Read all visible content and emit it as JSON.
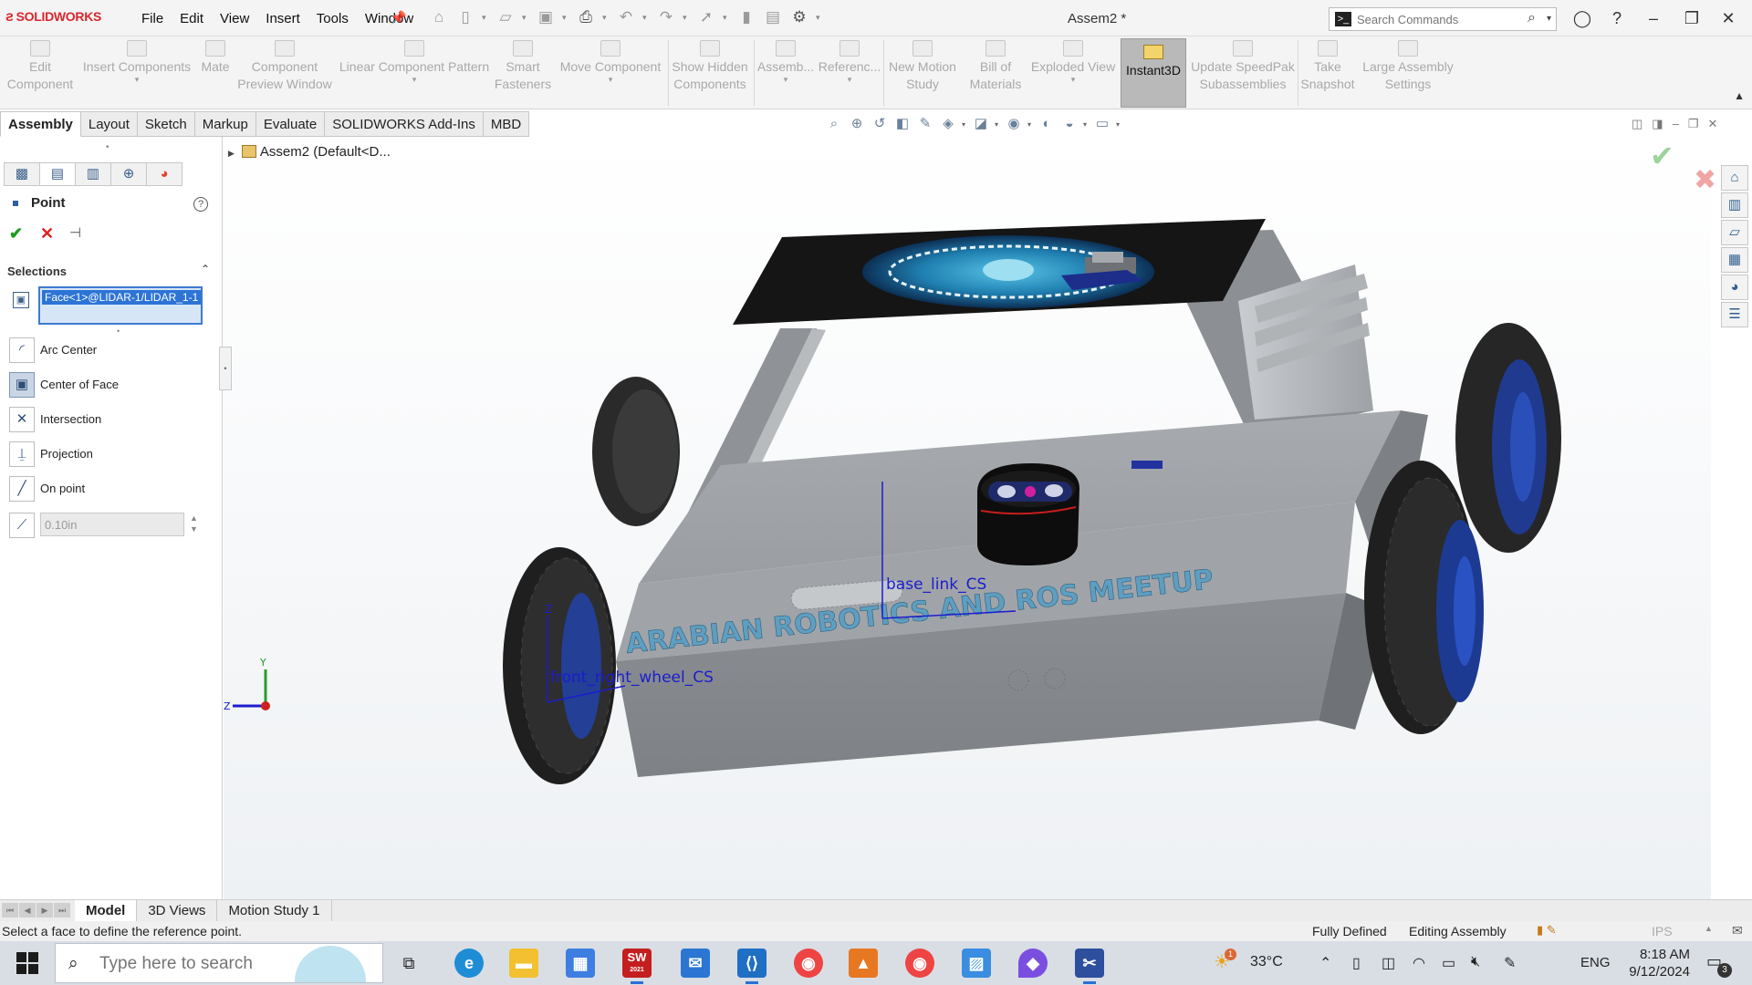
{
  "app": {
    "logo": "SOLIDWORKS",
    "document_title": "Assem2 *",
    "menus": [
      "File",
      "Edit",
      "View",
      "Insert",
      "Tools",
      "Window"
    ],
    "search_placeholder": "Search Commands"
  },
  "command_manager": {
    "buttons": [
      {
        "label1": "Edit",
        "label2": "Component"
      },
      {
        "label1": "Insert Components",
        "label2": ""
      },
      {
        "label1": "Mate",
        "label2": ""
      },
      {
        "label1": "Component",
        "label2": "Preview Window"
      },
      {
        "label1": "Linear Component Pattern",
        "label2": ""
      },
      {
        "label1": "Smart",
        "label2": "Fasteners"
      },
      {
        "label1": "Move Component",
        "label2": ""
      },
      {
        "label1": "Show Hidden",
        "label2": "Components"
      },
      {
        "label1": "Assemb...",
        "label2": ""
      },
      {
        "label1": "Referenc...",
        "label2": ""
      },
      {
        "label1": "New Motion",
        "label2": "Study"
      },
      {
        "label1": "Bill of",
        "label2": "Materials"
      },
      {
        "label1": "Exploded View",
        "label2": ""
      },
      {
        "label1": "Update SpeedPak",
        "label2": "Subassemblies"
      },
      {
        "label1": "Take",
        "label2": "Snapshot"
      },
      {
        "label1": "Large Assembly",
        "label2": "Settings"
      }
    ],
    "instant3d": "Instant3D"
  },
  "tabs": [
    {
      "label": "Assembly",
      "active": true
    },
    {
      "label": "Layout"
    },
    {
      "label": "Sketch"
    },
    {
      "label": "Markup"
    },
    {
      "label": "Evaluate"
    },
    {
      "label": "SOLIDWORKS Add-Ins"
    },
    {
      "label": "MBD"
    }
  ],
  "tree": {
    "root": "Assem2  (Default<D..."
  },
  "property_manager": {
    "title": "Point",
    "help": "?",
    "selections_header": "Selections",
    "selection_item": "Face<1>@LIDAR-1/LIDAR_1-1",
    "options": [
      {
        "label": "Arc Center"
      },
      {
        "label": "Center of Face",
        "selected": true
      },
      {
        "label": "Intersection"
      },
      {
        "label": "Projection"
      },
      {
        "label": "On point"
      }
    ],
    "distance_value": "0.10in"
  },
  "viewport": {
    "banner_text": "ARABIAN ROBOTICS AND ROS MEETUP",
    "cs_labels": [
      "base_link_CS",
      "front_right_wheel_CS"
    ],
    "triad": {
      "y": "Y",
      "z": "Z"
    }
  },
  "bottom_tabs": [
    {
      "label": "Model",
      "active": true
    },
    {
      "label": "3D Views"
    },
    {
      "label": "Motion Study 1"
    }
  ],
  "status": {
    "message": "Select a face to define the reference point.",
    "definition": "Fully Defined",
    "mode": "Editing Assembly",
    "units": "IPS"
  },
  "taskbar": {
    "search_placeholder": "Type here to search",
    "temperature": "33°C",
    "language": "ENG",
    "time": "8:18 AM",
    "date": "9/12/2024",
    "notification_count": "3",
    "weather_alert": "1",
    "sw_version": "2021"
  },
  "colors": {
    "accent": "#2d74d6",
    "solidworks_red": "#d9272e",
    "chassis": "#8e9296",
    "banner_text": "#5e9ec0",
    "cs_blue": "#1c1ccf"
  }
}
